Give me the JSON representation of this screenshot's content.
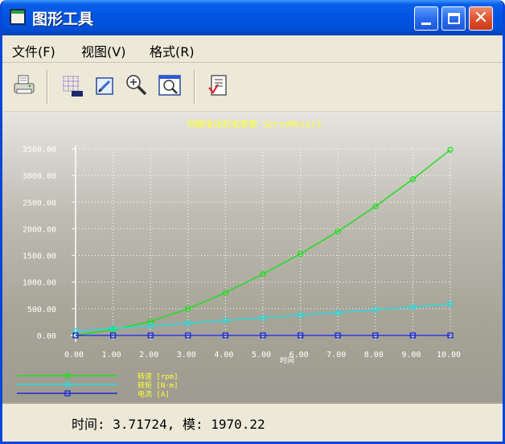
{
  "window": {
    "title": "图形工具"
  },
  "menu": [
    {
      "name": "menu-file",
      "label": "文件(F)"
    },
    {
      "name": "menu-view",
      "label": "视图(V)"
    },
    {
      "name": "menu-format",
      "label": "格式(R)"
    }
  ],
  "toolbar": [
    {
      "name": "print-button",
      "icon": "printer-icon"
    },
    {
      "name": "grid-button",
      "icon": "grid-icon"
    },
    {
      "name": "edit-button",
      "icon": "pencil-icon"
    },
    {
      "name": "zoom-in-button",
      "icon": "magnifier-plus-icon"
    },
    {
      "name": "zoom-window-button",
      "icon": "magnifier-window-icon"
    },
    {
      "name": "export-button",
      "icon": "document-check-icon"
    }
  ],
  "status": {
    "text": "时间: 3.71724, 模: 1970.22"
  },
  "chart_data": {
    "type": "line",
    "title": "伺服电动机电参数    ServoMotor2",
    "xlabel": "时间",
    "ylabel": "",
    "xlim": [
      0,
      10
    ],
    "ylim": [
      0,
      3500
    ],
    "grid": true,
    "x_ticks": [
      "0.00",
      "1.00",
      "2.00",
      "3.00",
      "4.00",
      "5.00",
      "6.00",
      "7.00",
      "8.00",
      "9.00",
      "10.00"
    ],
    "y_ticks": [
      "0.00",
      "500.00",
      "1000.00",
      "1500.00",
      "2000.00",
      "2500.00",
      "3000.00",
      "3500.00"
    ],
    "legend_position": "bottom-left",
    "series": [
      {
        "name": "转速 [rpm]",
        "color": "#22dd22",
        "marker": "circle",
        "x": [
          0,
          1,
          2,
          3,
          4,
          5,
          6,
          7,
          8,
          9,
          10
        ],
        "y": [
          0,
          110,
          260,
          500,
          800,
          1150,
          1530,
          1950,
          2420,
          2930,
          3480
        ]
      },
      {
        "name": "转矩 [N·m]",
        "color": "#22dddd",
        "marker": "circle",
        "x": [
          0,
          1,
          2,
          3,
          4,
          5,
          6,
          7,
          8,
          9,
          10
        ],
        "y": [
          80,
          130,
          180,
          230,
          280,
          330,
          380,
          430,
          480,
          530,
          590
        ]
      },
      {
        "name": "电流 [A]",
        "color": "#1a2ad8",
        "marker": "square",
        "x": [
          0,
          1,
          2,
          3,
          4,
          5,
          6,
          7,
          8,
          9,
          10
        ],
        "y": [
          0,
          0,
          0,
          0,
          0,
          0,
          0,
          0,
          0,
          0,
          0
        ]
      }
    ]
  }
}
